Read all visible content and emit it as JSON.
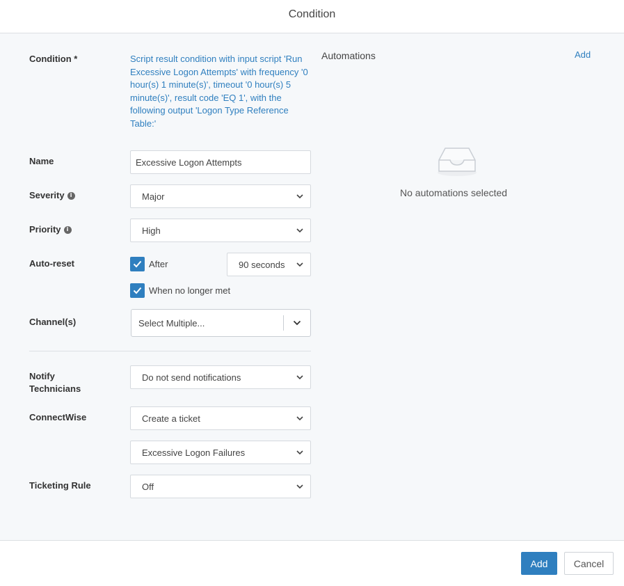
{
  "dialog": {
    "title": "Condition"
  },
  "form": {
    "condition": {
      "label": "Condition *",
      "text": "Script result condition with input script 'Run Excessive Logon Attempts' with frequency '0 hour(s) 1 minute(s)', timeout '0 hour(s) 5 minute(s)', result code 'EQ 1', with the following output 'Logon Type Reference Table:'"
    },
    "name": {
      "label": "Name",
      "value": "Excessive Logon Attempts"
    },
    "severity": {
      "label": "Severity",
      "value": "Major"
    },
    "priority": {
      "label": "Priority",
      "value": "High"
    },
    "auto_reset": {
      "label": "Auto-reset",
      "after_label": "After",
      "after_checked": true,
      "after_value": "90 seconds",
      "no_longer_met_label": "When no longer met",
      "no_longer_met_checked": true
    },
    "channels": {
      "label": "Channel(s)",
      "placeholder": "Select Multiple..."
    },
    "notify": {
      "label_line1": "Notify",
      "label_line2": "Technicians",
      "value": "Do not send notifications"
    },
    "connectwise": {
      "label": "ConnectWise",
      "value": "Create a ticket",
      "secondary_value": "Excessive Logon Failures"
    },
    "ticketing_rule": {
      "label": "Ticketing Rule",
      "value": "Off"
    }
  },
  "automations": {
    "title": "Automations",
    "add_label": "Add",
    "empty_text": "No automations selected"
  },
  "footer": {
    "add_label": "Add",
    "cancel_label": "Cancel"
  },
  "colors": {
    "accent": "#2f7fbf",
    "panel_bg": "#f6f8fa"
  },
  "icons": {
    "info": "info-icon",
    "select": "chevron-down-icon",
    "check": "checkmark-icon",
    "empty": "empty-inbox-icon"
  }
}
